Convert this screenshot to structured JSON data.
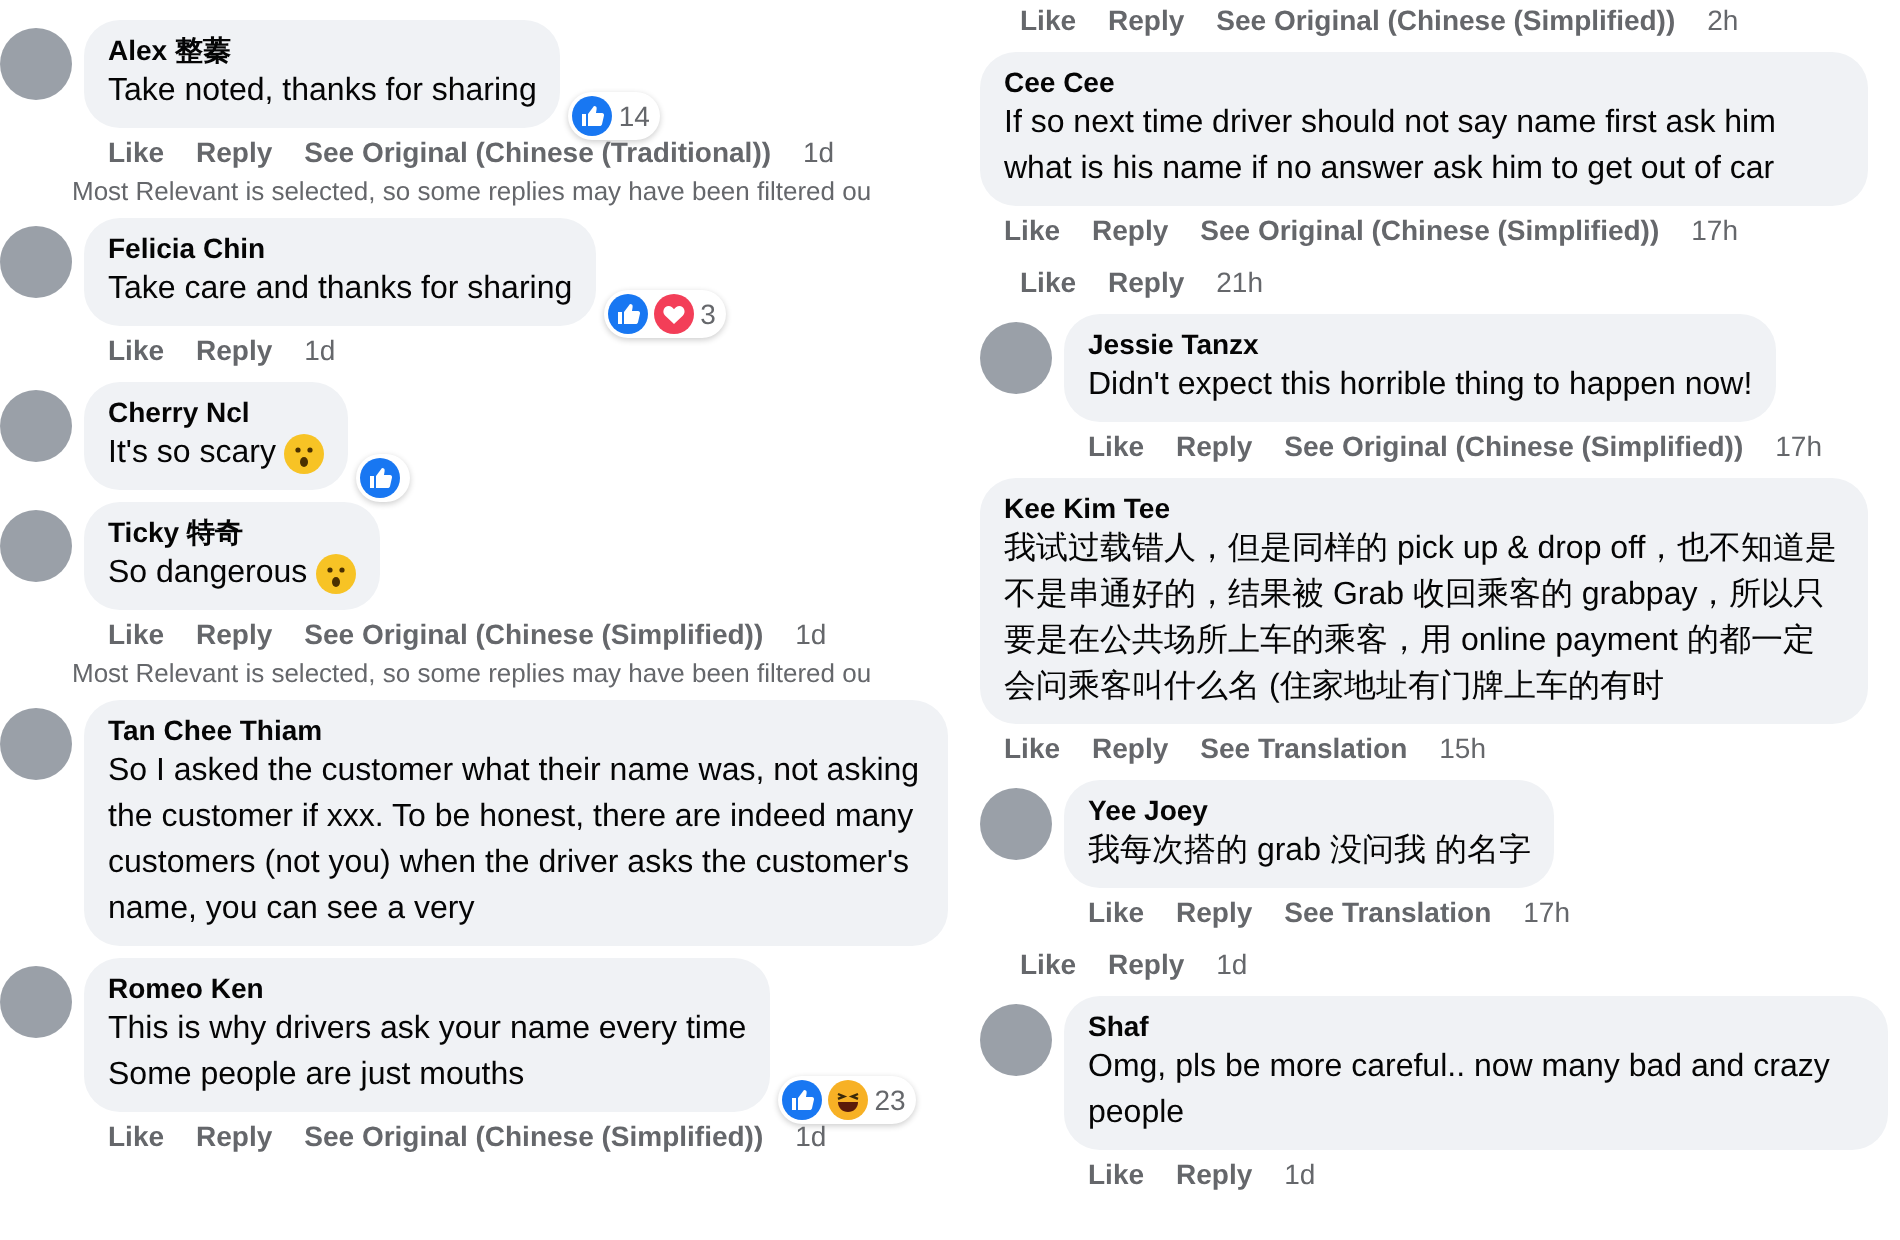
{
  "columns": [
    {
      "items": [
        {
          "kind": "comment",
          "avatar": true,
          "name": "Alex 整蓁",
          "text": "Take noted, thanks for sharing",
          "emoji": false,
          "reactions": {
            "icons": [
              {
                "kind": "like"
              }
            ],
            "count": "14"
          },
          "actions": [
            "Like",
            "Reply",
            "See Original (Chinese (Traditional))"
          ],
          "time": "1d",
          "note": "Most Relevant is selected, so some replies may have been filtered ou"
        },
        {
          "kind": "comment",
          "avatar": true,
          "name": "Felicia Chin",
          "text": "Take care and thanks for sharing",
          "emoji": false,
          "reactions": {
            "icons": [
              {
                "kind": "like"
              },
              {
                "kind": "love"
              }
            ],
            "count": "3"
          },
          "actions": [
            "Like",
            "Reply"
          ],
          "time": "1d"
        },
        {
          "kind": "comment",
          "avatar": true,
          "name": "Cherry Ncl",
          "text": "It's so scary",
          "emoji": true,
          "reactions": {
            "icons": [
              {
                "kind": "like"
              }
            ]
          }
        },
        {
          "kind": "comment",
          "avatar": true,
          "name": "Ticky 特奇",
          "text": "So dangerous",
          "emoji": true,
          "actions": [
            "Like",
            "Reply",
            "See Original (Chinese (Simplified))"
          ],
          "time": "1d",
          "note": "Most Relevant is selected, so some replies may have been filtered ou"
        },
        {
          "kind": "comment",
          "avatar": true,
          "name": "Tan Chee Thiam",
          "text": "So I asked the customer what their name was, not asking the customer if xxx. To be honest, there are indeed many customers (not you) when the driver asks the customer's name, you can see a very",
          "emoji": false
        },
        {
          "kind": "comment",
          "avatar": true,
          "name": "Romeo Ken",
          "text": "This is why drivers ask your name every time\nSome people are just mouths",
          "emoji": false,
          "reactions": {
            "icons": [
              {
                "kind": "like"
              },
              {
                "kind": "haha"
              }
            ],
            "count": "23"
          },
          "actions": [
            "Like",
            "Reply",
            "See Original (Chinese (Simplified))"
          ],
          "time": "1d"
        }
      ]
    },
    {
      "items": [
        {
          "kind": "actions",
          "actions": [
            "Like",
            "Reply",
            "See Original (Chinese (Simplified))"
          ],
          "time": "2h"
        },
        {
          "kind": "comment",
          "avatar": false,
          "name": "Cee Cee",
          "text": "If so next time driver should not say name first ask him what is his name if no answer ask him to get out of car",
          "emoji": false,
          "actions": [
            "Like",
            "Reply",
            "See Original (Chinese (Simplified))"
          ],
          "time": "17h"
        },
        {
          "kind": "actions",
          "actions": [
            "Like",
            "Reply"
          ],
          "time": "21h"
        },
        {
          "kind": "comment",
          "avatar": true,
          "name": "Jessie Tanzx",
          "text": "Didn't expect this horrible thing to happen now!",
          "emoji": false,
          "actions": [
            "Like",
            "Reply",
            "See Original (Chinese (Simplified))"
          ],
          "time": "17h"
        },
        {
          "kind": "comment",
          "avatar": false,
          "name": "Kee Kim Tee",
          "text": "我试过载错人，但是同样的 pick up & drop off，也不知道是不是串通好的，结果被 Grab 收回乘客的 grabpay，所以只要是在公共场所上车的乘客，用 online payment 的都一定会问乘客叫什么名 (住家地址有门牌上车的有时",
          "emoji": false,
          "actions": [
            "Like",
            "Reply",
            "See Translation"
          ],
          "time": "15h"
        },
        {
          "kind": "comment",
          "avatar": true,
          "name": "Yee Joey",
          "text": "我每次搭的 grab 没问我 的名字",
          "emoji": false,
          "actions": [
            "Like",
            "Reply",
            "See Translation"
          ],
          "time": "17h"
        },
        {
          "kind": "actions",
          "actions": [
            "Like",
            "Reply"
          ],
          "time": "1d"
        },
        {
          "kind": "comment",
          "avatar": true,
          "name": "Shaf",
          "text": "Omg, pls be more careful.. now many bad and crazy people",
          "emoji": false,
          "actions": [
            "Like",
            "Reply"
          ],
          "time": "1d"
        }
      ]
    }
  ]
}
